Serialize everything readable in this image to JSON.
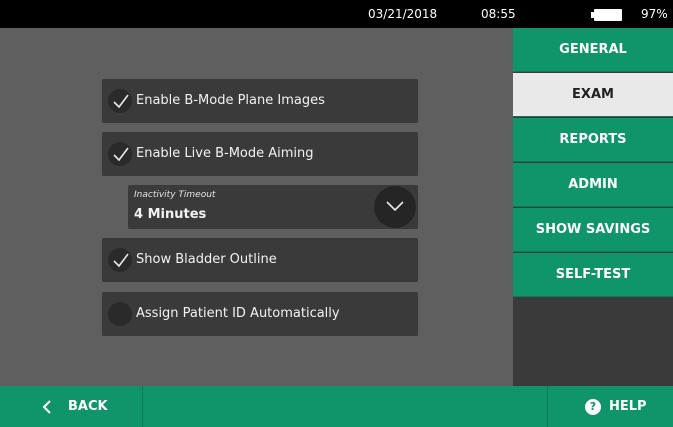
{
  "status_bar": {
    "date": "03/21/2018",
    "time": "08:55",
    "battery_percent": "97%",
    "battery_level": 0.97
  },
  "settings": {
    "rows": [
      {
        "label": "Enable B-Mode Plane Images",
        "checked": true
      },
      {
        "label": "Enable Live B-Mode Aiming",
        "checked": true
      },
      {
        "label": "Show Bladder Outline",
        "checked": true
      },
      {
        "label": "Assign Patient ID Automatically",
        "checked": false
      }
    ],
    "inactivity_timeout": {
      "caption": "Inactivity Timeout",
      "value": "4 Minutes"
    }
  },
  "sidebar": {
    "tabs": [
      {
        "label": "GENERAL",
        "active": false
      },
      {
        "label": "EXAM",
        "active": true
      },
      {
        "label": "REPORTS",
        "active": false
      },
      {
        "label": "ADMIN",
        "active": false
      },
      {
        "label": "SHOW SAVINGS",
        "active": false
      },
      {
        "label": "SELF-TEST",
        "active": false
      }
    ]
  },
  "footer": {
    "back_label": "BACK",
    "help_label": "HELP"
  },
  "colors": {
    "accent_green": "#10946a",
    "active_tab": "#e9e9e9",
    "background": "#5f5f5f",
    "row_background": "#3a3a3a"
  }
}
